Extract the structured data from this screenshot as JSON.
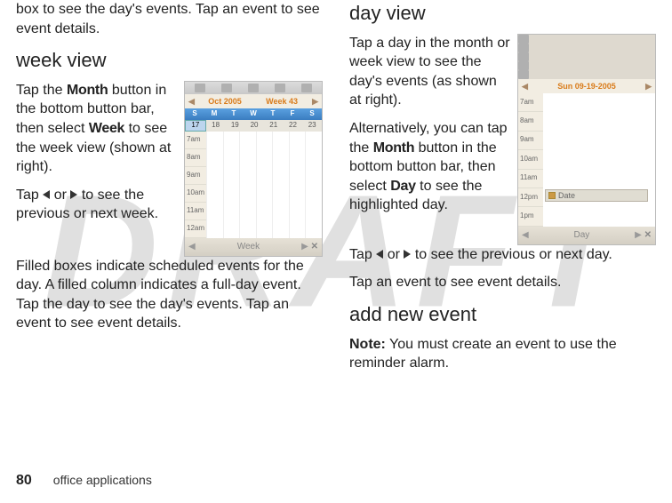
{
  "watermark": "DRAFT",
  "left": {
    "intro_frag": "box to see the day's events. Tap an event to see event details.",
    "heading_week": "week view",
    "week_p1_a": "Tap the ",
    "week_p1_month": "Month",
    "week_p1_b": " button in the bottom button bar, then select ",
    "week_p1_week": "Week",
    "week_p1_c": " to see the week view (shown at right).",
    "week_p2_a": "Tap ",
    "week_p2_b": " or ",
    "week_p2_c": " to see the previous or next week.",
    "week_p3": "Filled boxes indicate scheduled events for the day. A filled column indicates a full-day event. Tap the day to see the day's events. Tap an event to see event details."
  },
  "right": {
    "heading_day": "day view",
    "day_p1": "Tap a day in the month or week view to see the day's events (as shown at right).",
    "day_p2_a": "Alternatively, you can tap the ",
    "day_p2_month": "Month",
    "day_p2_b": " button in the bottom button bar, then select ",
    "day_p2_day": "Day",
    "day_p2_c": " to see the highlighted day.",
    "day_p3_a": "Tap ",
    "day_p3_b": " or ",
    "day_p3_c": " to see the previous or next day.",
    "day_p4": "Tap an event to see event details.",
    "heading_add": "add new event",
    "note_label": "Note:",
    "note_text": " You must create an event to use the reminder alarm."
  },
  "weekshot": {
    "title_left": "Oct 2005",
    "title_right": "Week 43",
    "dow": [
      "S",
      "M",
      "T",
      "W",
      "T",
      "F",
      "S"
    ],
    "dates": [
      "17",
      "18",
      "19",
      "20",
      "21",
      "22",
      "23"
    ],
    "hours": [
      "7am",
      "8am",
      "9am",
      "10am",
      "11am",
      "12am"
    ],
    "bottom_label": "Week"
  },
  "dayshot": {
    "title": "Sun 09-19-2005",
    "hours": [
      "7am",
      "8am",
      "9am",
      "10am",
      "11am",
      "12pm",
      "1pm"
    ],
    "event_label": "Date",
    "bottom_label": "Day"
  },
  "footer": {
    "page": "80",
    "label": "office applications"
  }
}
